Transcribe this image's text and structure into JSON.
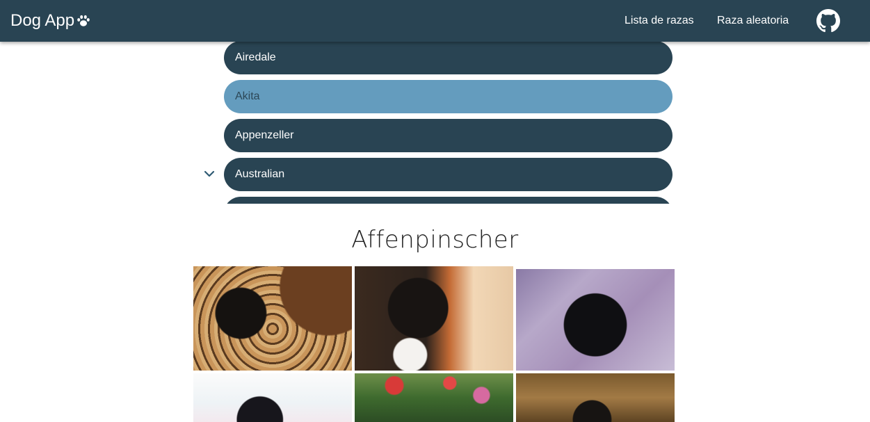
{
  "header": {
    "brand": "Dog App",
    "nav": [
      {
        "label": "Lista de razas"
      },
      {
        "label": "Raza aleatoria"
      }
    ]
  },
  "breeds": {
    "items": [
      {
        "label": "Airedale",
        "selected": false
      },
      {
        "label": "Akita",
        "selected": true
      },
      {
        "label": "Appenzeller",
        "selected": false
      },
      {
        "label": "Australian",
        "selected": false,
        "expandable": true
      },
      {
        "label": "",
        "selected": false
      }
    ]
  },
  "gallery": {
    "title": "Affenpinscher",
    "photos": [
      {
        "alt": "affenpinscher-photo-1"
      },
      {
        "alt": "affenpinscher-photo-2"
      },
      {
        "alt": "affenpinscher-photo-3"
      },
      {
        "alt": "affenpinscher-photo-4"
      },
      {
        "alt": "affenpinscher-photo-5"
      },
      {
        "alt": "affenpinscher-photo-6"
      }
    ]
  },
  "colors": {
    "primary": "#294453",
    "selected": "#649cbe"
  },
  "icons": {
    "brand": "paw-icon",
    "github": "github-icon",
    "expand": "chevron-down-icon"
  }
}
